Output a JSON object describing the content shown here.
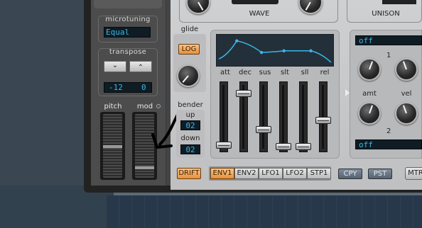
{
  "left_panel": {
    "microtuning_label": "microtuning",
    "microtuning_value": "Equal",
    "transpose_label": "transpose",
    "transpose_down_glyph": "⌄",
    "transpose_up_glyph": "⌃",
    "transpose_semitones": "-12",
    "transpose_cents": "0",
    "pitch_label": "pitch",
    "mod_label": "mod"
  },
  "glide": {
    "label": "glide",
    "log_button": "LOG"
  },
  "bender": {
    "label": "bender",
    "up_label": "up",
    "up_value": "02",
    "down_label": "down",
    "down_value": "02"
  },
  "top": {
    "wave_label": "WAVE",
    "unison_label": "UNISON"
  },
  "envelope": {
    "slider_labels": [
      "att",
      "dec",
      "sus",
      "slt",
      "sll",
      "rel"
    ],
    "slider_levels": [
      0.05,
      0.9,
      0.3,
      0.02,
      0.02,
      0.45
    ],
    "curve_points": [
      [
        0,
        0.18
      ],
      [
        0.16,
        0.85
      ],
      [
        0.38,
        0.42
      ],
      [
        0.58,
        0.48
      ],
      [
        0.82,
        0.48
      ],
      [
        1,
        0.05
      ]
    ]
  },
  "drift_button": "DRIFT",
  "tabs": [
    "ENV1",
    "ENV2",
    "LFO1",
    "LFO2",
    "STP1"
  ],
  "active_tab": "ENV1",
  "copy_button": "CPY",
  "paste_button": "PST",
  "mtr_button": "MTR",
  "mod_matrix": {
    "slot1_source": "off",
    "slot2_source": "off",
    "num1": "1",
    "num2": "2",
    "amt_label": "amt",
    "vel_label": "vel"
  },
  "colors": {
    "accent_orange": "#f0a050",
    "lcd_blue": "#3ab6e8",
    "panel_light": "#c8c9cb",
    "panel_dark": "#4c4c4c"
  }
}
